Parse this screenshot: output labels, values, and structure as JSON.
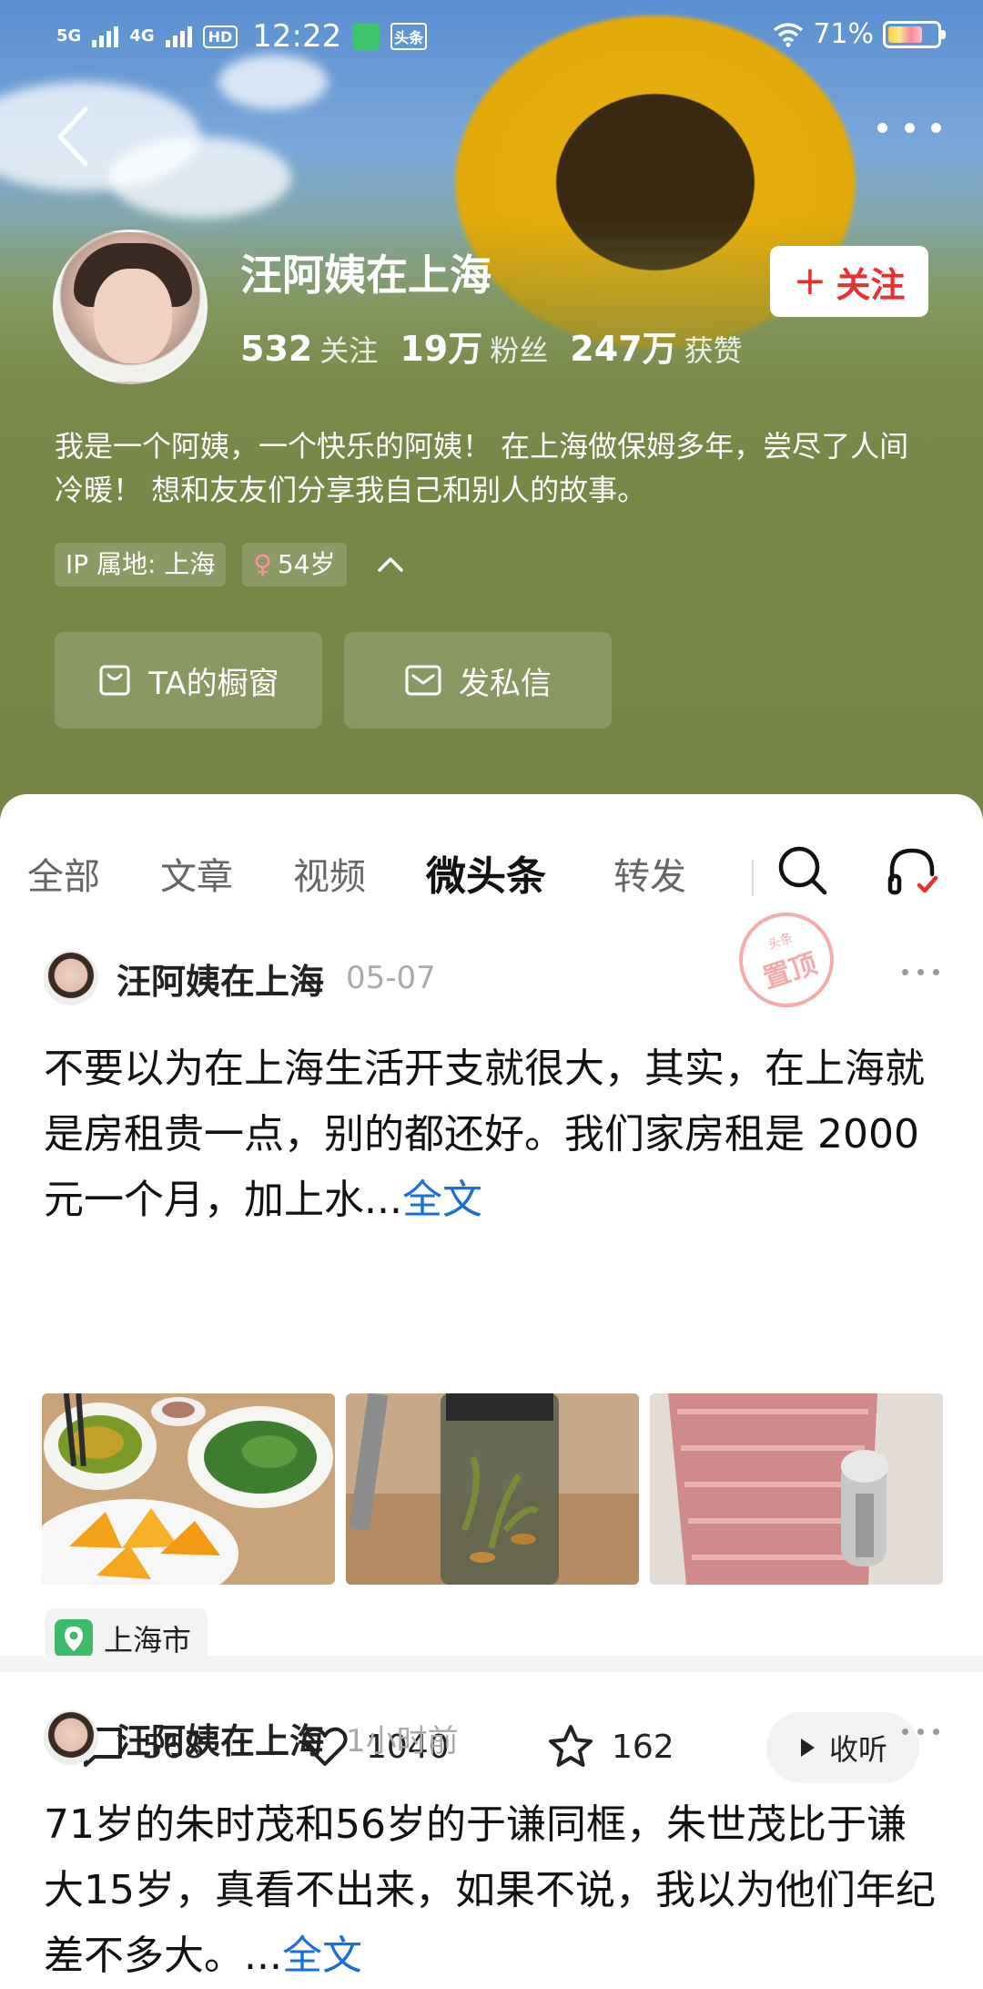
{
  "status_bar": {
    "net1": "5G",
    "net2": "4G",
    "hd": "HD",
    "time": "12:22",
    "app_badge": "头条",
    "battery": "71%"
  },
  "profile": {
    "name": "汪阿姨在上海",
    "following_count": "532",
    "following_label": "关注",
    "fans_count": "19万",
    "fans_label": "粉丝",
    "likes_count": "247万",
    "likes_label": "获赞",
    "follow_button": "关注",
    "bio": "我是一个阿姨，一个快乐的阿姨！ 在上海做保姆多年，尝尽了人间冷暖！ 想和友友们分享我自己和别人的故事。",
    "ip_tag": "IP 属地: 上海",
    "age_tag": "54岁",
    "shop_button": "TA的橱窗",
    "message_button": "发私信"
  },
  "tabs": [
    "全部",
    "文章",
    "视频",
    "微头条",
    "转发"
  ],
  "active_tab": "微头条",
  "posts": [
    {
      "author": "汪阿姨在上海",
      "time": "05-07",
      "pin_top": "头条",
      "pin_main": "置顶",
      "text": "不要以为在上海生活开支就很大，其实，在上海就是房租贵一点，别的都还好。我们家房租是 2000元一个月，加上水...",
      "more_link": "全文",
      "location": "上海市",
      "comments": "568",
      "likes": "1040",
      "favorites": "162",
      "listen": "收听"
    },
    {
      "author": "汪阿姨在上海",
      "time": "1小时前",
      "text": "71岁的朱时茂和56岁的于谦同框，朱世茂比于谦大15岁，真看不出来，如果不说，我以为他们年纪差不多大。...",
      "more_link": "全文"
    }
  ],
  "colors": {
    "accent_red": "#e8312f",
    "link_blue": "#1a6fd9"
  }
}
